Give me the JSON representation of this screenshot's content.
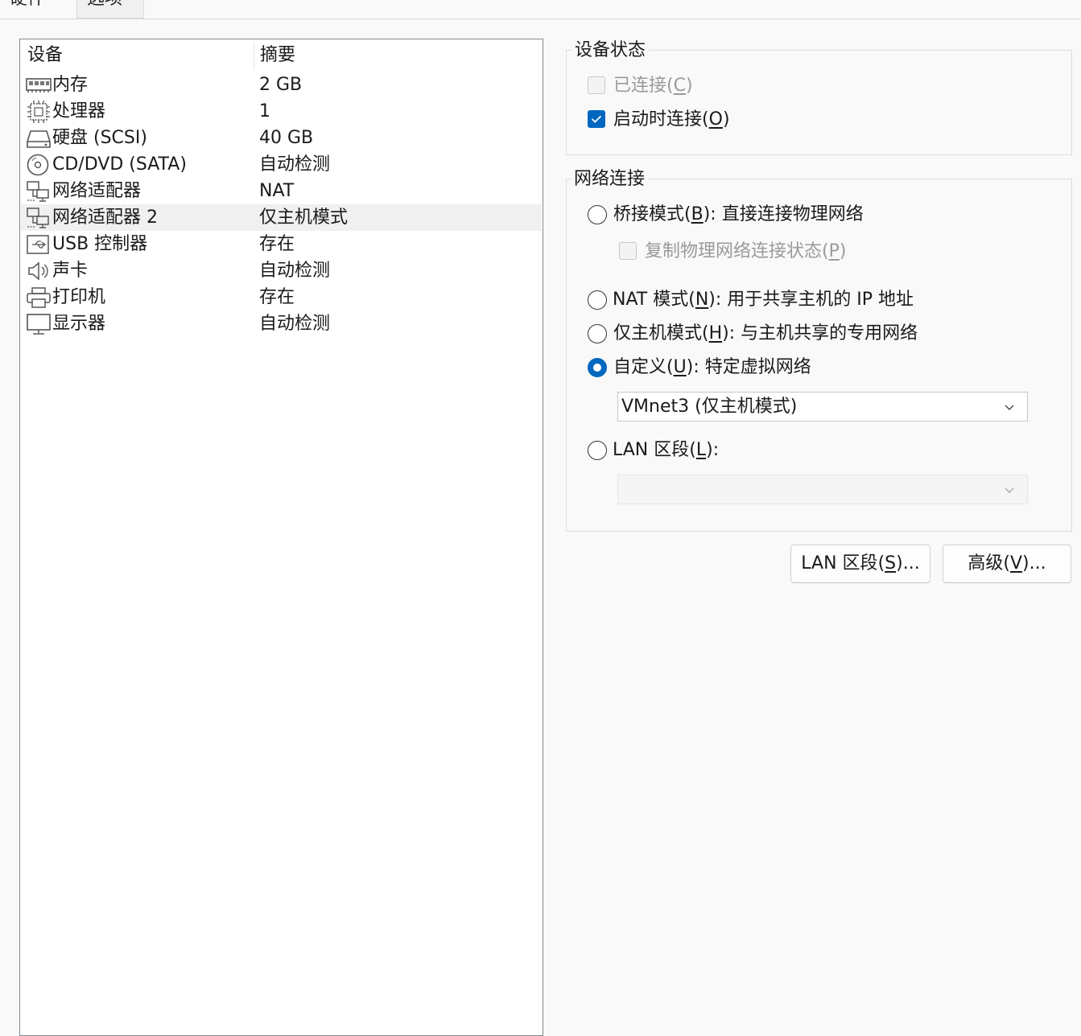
{
  "tabs": [
    {
      "label": "硬件"
    },
    {
      "label": "选项"
    }
  ],
  "device_list": {
    "headers": {
      "device": "设备",
      "summary": "摘要"
    },
    "rows": [
      {
        "icon": "memory-icon",
        "name": "内存",
        "summary": "2 GB",
        "selected": false
      },
      {
        "icon": "processor-icon",
        "name": "处理器",
        "summary": "1",
        "selected": false
      },
      {
        "icon": "hard-disk-icon",
        "name": "硬盘 (SCSI)",
        "summary": "40 GB",
        "selected": false
      },
      {
        "icon": "cd-dvd-icon",
        "name": "CD/DVD (SATA)",
        "summary": "自动检测",
        "selected": false
      },
      {
        "icon": "network-adapter-icon",
        "name": "网络适配器",
        "summary": "NAT",
        "selected": false
      },
      {
        "icon": "network-adapter-icon",
        "name": "网络适配器 2",
        "summary": "仅主机模式",
        "selected": true
      },
      {
        "icon": "usb-icon",
        "name": "USB 控制器",
        "summary": "存在",
        "selected": false
      },
      {
        "icon": "speaker-icon",
        "name": "声卡",
        "summary": "自动检测",
        "selected": false
      },
      {
        "icon": "printer-icon",
        "name": "打印机",
        "summary": "存在",
        "selected": false
      },
      {
        "icon": "monitor-icon",
        "name": "显示器",
        "summary": "自动检测",
        "selected": false
      }
    ]
  },
  "device_status": {
    "title": "设备状态",
    "connected": {
      "label": "已连接",
      "key": "C",
      "checked": false,
      "enabled": false
    },
    "connect_at_power_on": {
      "label": "启动时连接",
      "key": "O",
      "checked": true,
      "enabled": true
    }
  },
  "network_connection": {
    "title": "网络连接",
    "bridged": {
      "label": "桥接模式",
      "key": "B",
      "desc": ": 直接连接物理网络",
      "selected": false
    },
    "replicate": {
      "label": "复制物理网络连接状态",
      "key": "P",
      "checked": false,
      "enabled": false
    },
    "nat": {
      "label": "NAT 模式",
      "key": "N",
      "desc": ": 用于共享主机的 IP 地址",
      "selected": false
    },
    "host_only": {
      "label": "仅主机模式",
      "key": "H",
      "desc": ": 与主机共享的专用网络",
      "selected": false
    },
    "custom": {
      "label": "自定义",
      "key": "U",
      "desc": ": 特定虚拟网络",
      "selected": true
    },
    "custom_select_value": "VMnet3 (仅主机模式)",
    "lan_segment": {
      "label": "LAN 区段",
      "key": "L",
      "desc": ":",
      "selected": false
    },
    "lan_select_value": ""
  },
  "buttons": {
    "lan_segments": {
      "label": "LAN 区段",
      "key": "S",
      "suffix": "..."
    },
    "advanced": {
      "label": "高级",
      "key": "V",
      "suffix": "..."
    }
  },
  "colors": {
    "accent": "#0067c0",
    "selected_row": "#f0f0f0",
    "border": "#828790"
  }
}
